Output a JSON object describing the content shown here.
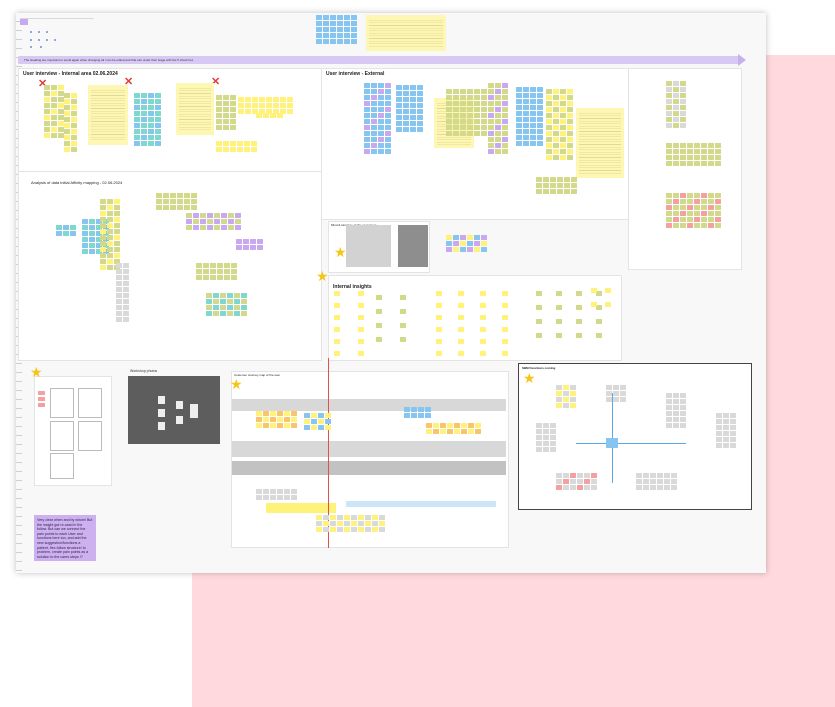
{
  "board": {
    "banner_text": "The Heading are important to avoid again when changing all / can be edited and that can under their stage with the 5 check box",
    "frames": {
      "internal": {
        "title": "User interview - Internal area 02.06.2024"
      },
      "external": {
        "title": "User interview - External"
      },
      "affinity": {
        "title": "Analysis of data initial Affinity mapping - 02.06.2024"
      },
      "insights": {
        "title": "Internal insights"
      },
      "ecosystem": {
        "title": "Mind & structure of the ecosystem"
      },
      "photo": {
        "title": "Workshop photos"
      },
      "journey": {
        "title": "Customer Journey map of the user"
      },
      "sbm": {
        "title": "SBM Functions coming"
      }
    },
    "purple_note": "Very clear when and by whom! But the insight got re-used in the follow. But can we connect the pain points to each User and functions here too, and add the new suggestion/functions a patient, flex-follow structure/ to problem, create pain points as a solution to the users steps !?"
  }
}
